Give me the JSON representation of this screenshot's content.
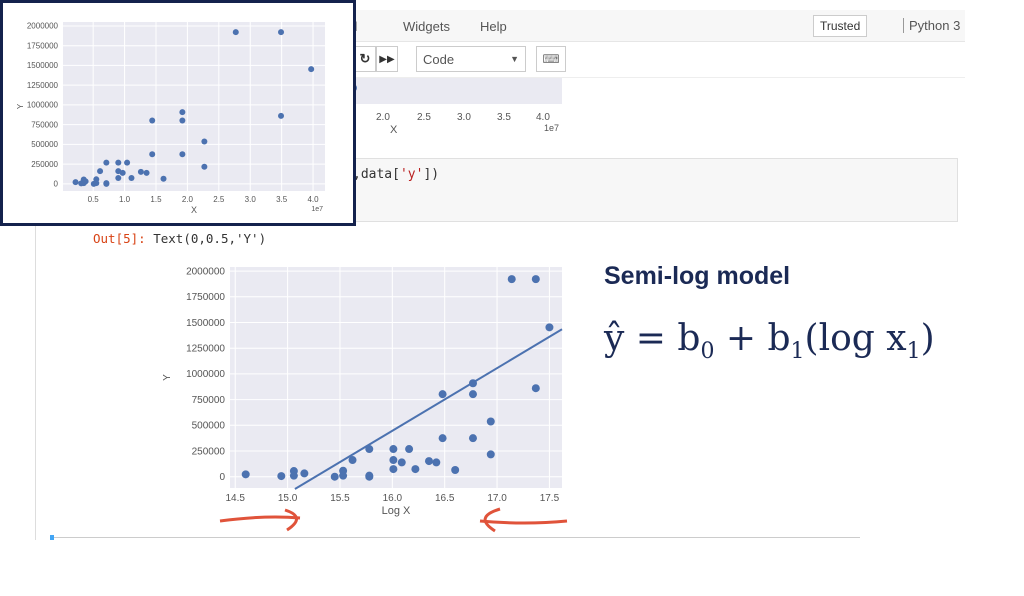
{
  "menubar": {
    "items": [
      "nel",
      "Widgets",
      "Help"
    ],
    "trusted": "Trusted",
    "kernel": "Python 3"
  },
  "toolbar": {
    "restart_icon": "restart-icon",
    "run_all_icon": "fast-forward-icon",
    "cell_type": "Code",
    "keyboard_icon": "keyboard-icon"
  },
  "cell": {
    "code_pre": ",data[",
    "code_str": "'y'",
    "code_post": "])"
  },
  "output": {
    "prompt": "Out[5]:",
    "text": "Text(0,0.5,'Y')"
  },
  "annotation": {
    "title": "Semi-log model",
    "formula": {
      "lhs": "ŷ = b",
      "sub0": "0",
      "mid": " + b",
      "sub1": "1",
      "log": "(log x",
      "sub2": "1",
      "end": ")"
    }
  },
  "colors": {
    "point": "#4c72b0",
    "plot_bg": "#eaeaf2",
    "frame": "#14224d",
    "arrow": "#e0533a",
    "text_navy": "#1b2a55"
  },
  "chart_data": [
    {
      "type": "scatter",
      "xlabel": "X",
      "ylabel": "Y",
      "x_offset_label": "1e7",
      "xticks": [
        0.5,
        1.0,
        1.5,
        2.0,
        2.5,
        3.0,
        3.5,
        4.0
      ],
      "yticks": [
        0,
        250000,
        500000,
        750000,
        1000000,
        1250000,
        1500000,
        1750000,
        2000000
      ],
      "xlim": [
        0.02,
        4.19
      ],
      "ylim": [
        -90000,
        2050000
      ],
      "grid": true,
      "x": [
        0.22,
        0.31,
        0.35,
        0.35,
        0.38,
        0.51,
        0.55,
        0.55,
        0.61,
        0.71,
        0.71,
        0.71,
        0.9,
        0.9,
        0.9,
        0.97,
        1.04,
        1.11,
        1.26,
        1.35,
        1.44,
        1.44,
        1.62,
        1.92,
        1.92,
        1.92,
        2.27,
        2.27,
        2.77,
        3.49,
        3.49,
        3.97
      ],
      "y": [
        23000,
        6000,
        55000,
        10000,
        32000,
        0,
        58000,
        10000,
        162000,
        269000,
        10000,
        0,
        269000,
        162000,
        74000,
        139000,
        269000,
        74000,
        152000,
        139000,
        375000,
        803000,
        65000,
        909000,
        803000,
        375000,
        537000,
        217000,
        1922000,
        1922000,
        861000,
        1453000
      ]
    },
    {
      "type": "scatter",
      "xlabel": "Log X",
      "ylabel": "Y",
      "xticks": [
        14.5,
        15.0,
        15.5,
        16.0,
        16.5,
        17.0,
        17.5
      ],
      "yticks": [
        0,
        250000,
        500000,
        750000,
        1000000,
        1250000,
        1500000,
        1750000,
        2000000
      ],
      "xlim": [
        14.45,
        17.62
      ],
      "ylim": [
        -110000,
        2040000
      ],
      "grid": true,
      "x": [
        14.6,
        14.94,
        15.06,
        15.06,
        15.16,
        15.45,
        15.53,
        15.53,
        15.62,
        15.78,
        15.78,
        15.78,
        16.01,
        16.01,
        16.01,
        16.09,
        16.16,
        16.22,
        16.35,
        16.42,
        16.48,
        16.48,
        16.6,
        16.77,
        16.77,
        16.77,
        16.94,
        16.94,
        17.14,
        17.37,
        17.37,
        17.5
      ],
      "y": [
        23000,
        6000,
        55000,
        10000,
        32000,
        0,
        58000,
        10000,
        162000,
        269000,
        10000,
        0,
        269000,
        162000,
        74000,
        139000,
        269000,
        74000,
        152000,
        139000,
        375000,
        803000,
        65000,
        909000,
        803000,
        375000,
        537000,
        217000,
        1922000,
        1922000,
        861000,
        1453000
      ],
      "regression_line": [
        [
          15.07,
          -120000
        ],
        [
          17.62,
          1434000
        ]
      ]
    }
  ]
}
